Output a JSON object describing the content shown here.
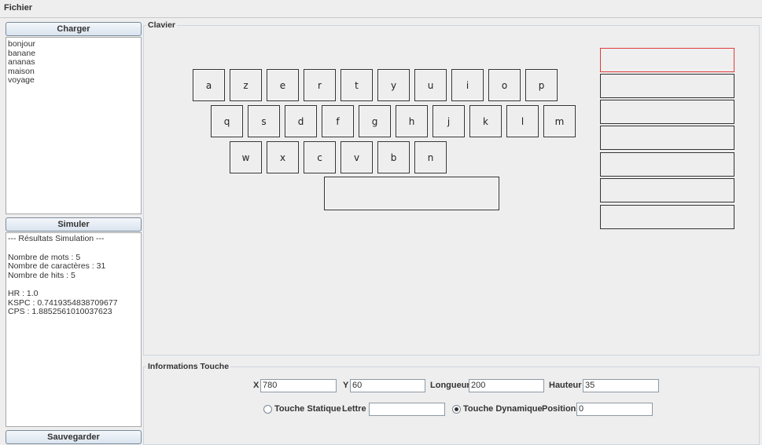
{
  "menu": {
    "fichier": "Fichier"
  },
  "left_panel": {
    "charger_label": "Charger",
    "words": [
      "bonjour",
      "banane",
      "ananas",
      "maison",
      "voyage"
    ],
    "simuler_label": "Simuler",
    "results": [
      "--- Résultats Simulation ---",
      "",
      "Nombre de mots : 5",
      "Nombre de caractères : 31",
      "Nombre de hits : 5",
      "",
      "HR : 1.0",
      "KSPC : 0.7419354838709677",
      "CPS : 1.8852561010037623"
    ],
    "sauvegarder_label": "Sauvegarder"
  },
  "clavier": {
    "title": "Clavier",
    "row1": [
      "a",
      "z",
      "e",
      "r",
      "t",
      "y",
      "u",
      "i",
      "o",
      "p"
    ],
    "row2": [
      "q",
      "s",
      "d",
      "f",
      "g",
      "h",
      "j",
      "k",
      "l",
      "m"
    ],
    "row3": [
      "w",
      "x",
      "c",
      "v",
      "b",
      "n"
    ]
  },
  "info": {
    "title": "Informations Touche",
    "x_label": "X",
    "x_value": "780",
    "y_label": "Y",
    "y_value": "60",
    "longueur_label": "Longueur",
    "longueur_value": "200",
    "hauteur_label": "Hauteur",
    "hauteur_value": "35",
    "statique_label": "Touche Statique",
    "statique_selected": false,
    "lettre_label": "Lettre",
    "lettre_value": "",
    "dynamique_label": "Touche Dynamique",
    "dynamique_selected": true,
    "position_label": "Position",
    "position_value": "0"
  },
  "colors": {
    "active_slot_border": "#e03a3a",
    "button_gradient_bottom": "#d9e3ef"
  }
}
